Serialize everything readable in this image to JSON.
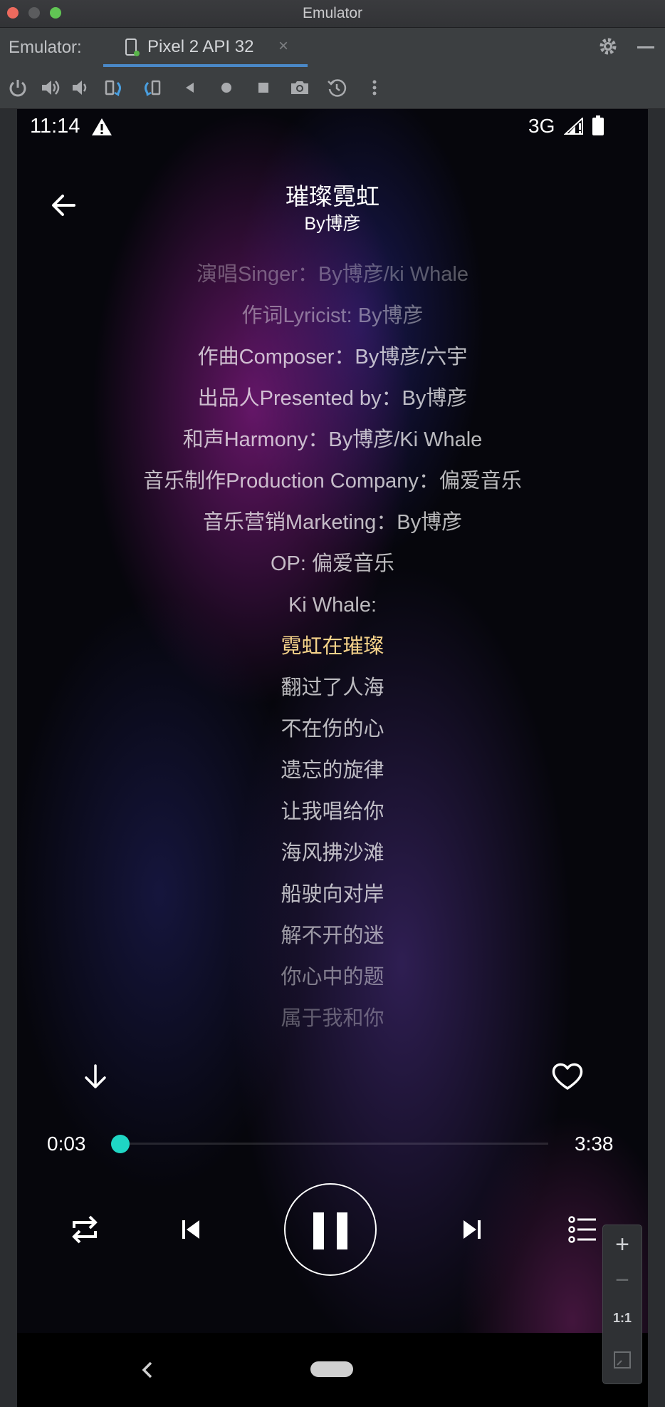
{
  "window": {
    "title": "Emulator"
  },
  "tabbar": {
    "label": "Emulator:",
    "tab_name": "Pixel 2 API 32",
    "close": "×"
  },
  "toolbar": {
    "buttons": [
      "power-icon",
      "volume-up-icon",
      "volume-down-icon",
      "rotate-left-icon",
      "rotate-right-icon",
      "back-icon",
      "home-icon",
      "overview-icon",
      "camera-icon",
      "snapshot-icon",
      "more-icon"
    ]
  },
  "status": {
    "time": "11:14",
    "network": "3G"
  },
  "song": {
    "title": "璀璨霓虹",
    "artist": "By博彦"
  },
  "lyrics": [
    "演唱Singer：By博彦/ki Whale",
    "作词Lyricist: By博彦",
    "作曲Composer：By博彦/六宇",
    "出品人Presented by：By博彦",
    "和声Harmony：By博彦/Ki Whale",
    "音乐制作Production Company：偏爱音乐",
    "音乐营销Marketing：By博彦",
    "OP: 偏爱音乐",
    "Ki Whale:",
    "霓虹在璀璨",
    "翻过了人海",
    "不在伤的心",
    "遗忘的旋律",
    "让我唱给你",
    "海风拂沙滩",
    "船驶向对岸",
    "解不开的迷",
    "你心中的题",
    "属于我和你"
  ],
  "current_lyric_index": 9,
  "player": {
    "current_time": "0:03",
    "total_time": "3:38",
    "progress": 0.014
  },
  "zoom": {
    "plus": "+",
    "minus": "−",
    "ratio": "1:1"
  },
  "colors": {
    "highlight": "#f6d38a",
    "accent": "#1fd6c4",
    "tab_underline": "#4a88c7"
  }
}
